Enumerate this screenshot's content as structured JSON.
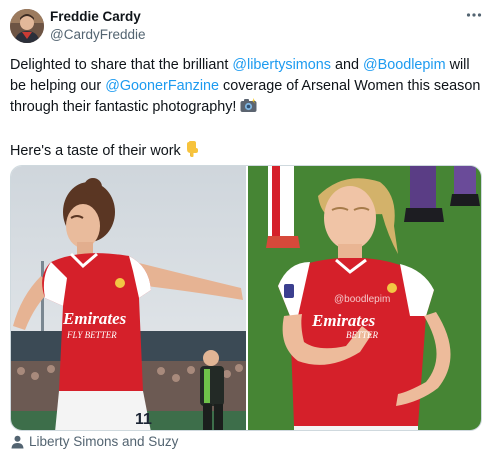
{
  "author": {
    "name": "Freddie Cardy",
    "handle": "@CardyFreddie",
    "avatar_icon": "profile-photo-icon"
  },
  "more_icon": "more-dots-icon",
  "tweet": {
    "line1": {
      "t1": "Delighted to share that the brilliant ",
      "m1": "@libertysimons",
      "t2": " and ",
      "m2": "@Boodlepim",
      "t3": " will"
    },
    "line2": {
      "t1": "be helping our ",
      "m1": "@GoonerFanzine",
      "t2": " coverage of Arsenal Women this season"
    },
    "line3": {
      "t1": "through their fantastic photography! ",
      "emoji": "camera-flash-emoji"
    },
    "line4": {
      "t1": "Here's a taste of their work ",
      "emoji": "pointing-down-emoji"
    }
  },
  "media": {
    "photo1": {
      "shirt_sponsor": "Emirates",
      "shirt_sponsor_sub": "FLY BETTER",
      "shorts_number": "11"
    },
    "photo2": {
      "watermark": "@boodlepim",
      "shirt_sponsor": "Emirates",
      "shirt_sponsor_sub": "BETTER"
    }
  },
  "tagged": {
    "icon": "person-icon",
    "label": "Liberty Simons and Suzy"
  },
  "colors": {
    "link": "#1d9bf0",
    "secondary_text": "#536471",
    "arsenal_red": "#d5202a"
  }
}
